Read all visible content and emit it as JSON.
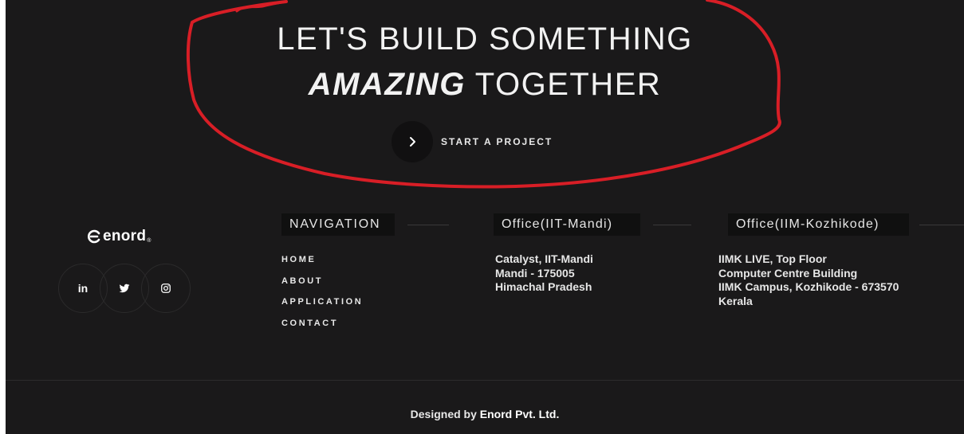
{
  "hero": {
    "line1": "LET'S BUILD SOMETHING",
    "line2_emphasis": "AMAZING",
    "line2_rest": "TOGETHER",
    "cta_label": "START A PROJECT",
    "annotation_color": "#d81e26"
  },
  "brand": {
    "logo_text": "enord",
    "logo_reg": "®"
  },
  "social": [
    {
      "name": "linkedin",
      "label": "in"
    },
    {
      "name": "twitter"
    },
    {
      "name": "instagram"
    }
  ],
  "navigation": {
    "heading": "NAVIGATION",
    "items": [
      "HOME",
      "ABOUT",
      "APPLICATION",
      "CONTACT"
    ]
  },
  "offices": [
    {
      "heading": "Office(IIT-Mandi)",
      "lines": [
        "Catalyst, IIT-Mandi",
        "Mandi - 175005",
        "Himachal Pradesh"
      ]
    },
    {
      "heading": "Office(IIM-Kozhikode)",
      "lines": [
        "IIMK LIVE, Top Floor",
        "Computer Centre Building",
        "IIMK Campus, Kozhikode - 673570",
        "Kerala"
      ]
    }
  ],
  "footer": {
    "credit_prefix": "Designed by",
    "credit_brand": "Enord Pvt. Ltd."
  },
  "colors": {
    "background": "#1a191a",
    "text": "#f2f2f2",
    "annotation": "#d81e26"
  }
}
